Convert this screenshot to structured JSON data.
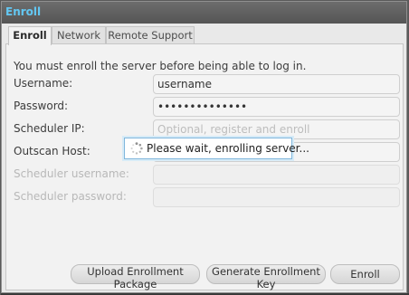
{
  "window": {
    "title": "Enroll"
  },
  "tabs": [
    {
      "label": "Enroll",
      "active": true
    },
    {
      "label": "Network",
      "active": false
    },
    {
      "label": "Remote Support",
      "active": false
    }
  ],
  "message": "You must enroll the server before being able to log in.",
  "form": {
    "username": {
      "label": "Username:",
      "value": "username"
    },
    "password": {
      "label": "Password:",
      "value": "••••••••••••••"
    },
    "scheduler_ip": {
      "label": "Scheduler IP:",
      "placeholder": "Optional, register and enroll"
    },
    "outscan_host": {
      "label": "Outscan Host:",
      "value": ""
    },
    "scheduler_username": {
      "label": "Scheduler username:",
      "value": ""
    },
    "scheduler_password": {
      "label": "Scheduler password:",
      "value": ""
    }
  },
  "wait_popup": {
    "text": "Please wait, enrolling server...",
    "icon": "spinner-icon"
  },
  "buttons": {
    "upload": "Upload Enrollment Package",
    "generate": "Generate Enrollment Key",
    "enroll": "Enroll"
  },
  "colors": {
    "title": "#63c7f2",
    "popup_border": "#7fb6dc"
  }
}
